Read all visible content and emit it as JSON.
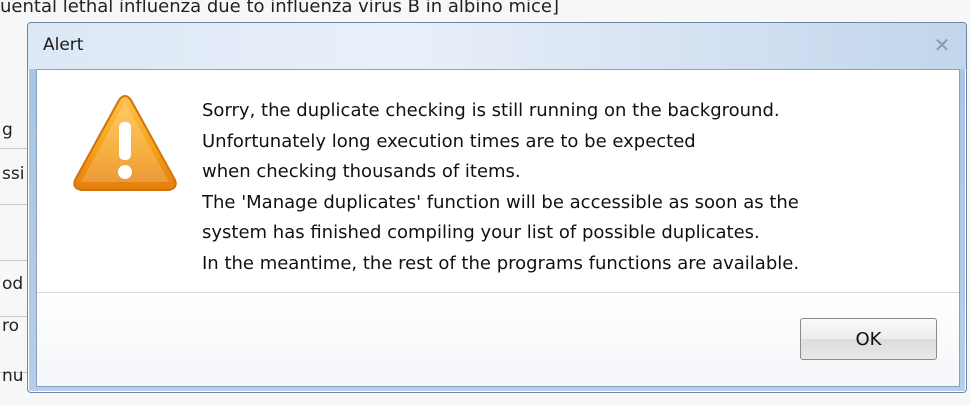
{
  "background": {
    "top_text": "uental lethal influenza due to influenza virus B in albino mice]",
    "rows": [
      "g",
      "ssi",
      "",
      "od",
      "ro",
      "nu"
    ]
  },
  "dialog": {
    "title": "Alert",
    "close_icon": "close-icon",
    "warning_icon": "warning-triangle-icon",
    "message_lines": [
      "Sorry, the duplicate checking is still running on the background.",
      "Unfortunately long execution times are to be expected",
      "when checking thousands of items.",
      "The 'Manage duplicates' function will be accessible as soon as the",
      "system has finished compiling your list of possible duplicates.",
      "In the meantime, the rest of the programs functions are available."
    ],
    "ok_label": "OK"
  },
  "colors": {
    "warning_orange": "#f39c12",
    "frame_blue": "#aac3e3"
  }
}
